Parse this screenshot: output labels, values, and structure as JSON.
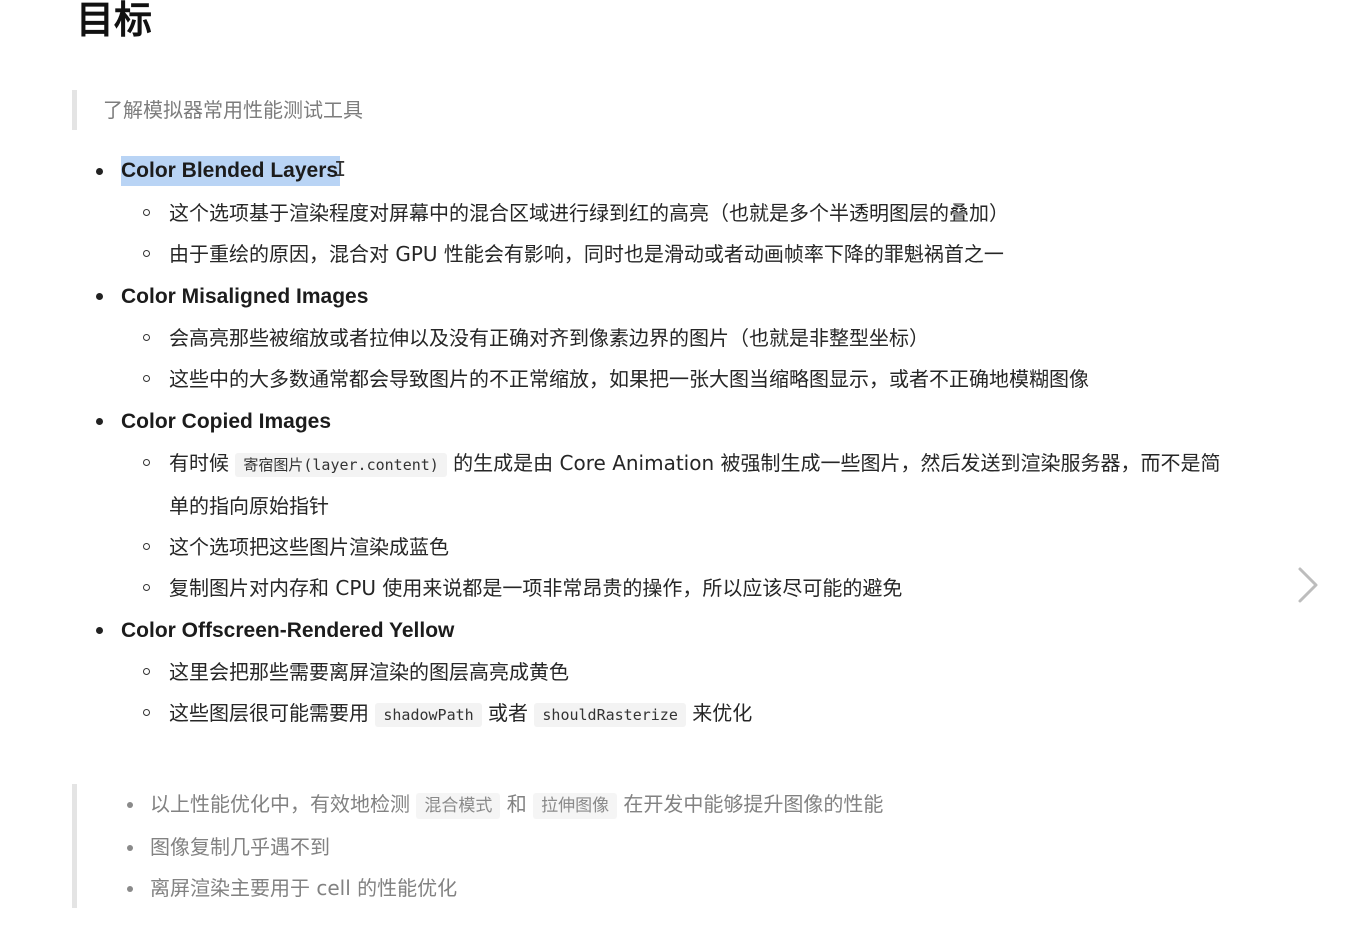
{
  "title": "目标",
  "intro_quote": "了解模拟器常用性能测试工具",
  "sections": [
    {
      "heading": "Color Blended Layers",
      "items": [
        {
          "text": "这个选项基于渲染程度对屏幕中的混合区域进行绿到红的高亮（也就是多个半透明图层的叠加）"
        },
        {
          "text": "由于重绘的原因，混合对 GPU 性能会有影响，同时也是滑动或者动画帧率下降的罪魁祸首之一"
        }
      ]
    },
    {
      "heading": "Color Misaligned Images",
      "items": [
        {
          "text": "会高亮那些被缩放或者拉伸以及没有正确对齐到像素边界的图片（也就是非整型坐标）"
        },
        {
          "text": "这些中的大多数通常都会导致图片的不正常缩放，如果把一张大图当缩略图显示，或者不正确地模糊图像"
        }
      ]
    },
    {
      "heading": "Color Copied Images",
      "items": [
        {
          "pre": "有时候 ",
          "code": "寄宿图片(layer.content)",
          "post": " 的生成是由 Core Animation 被强制生成一些图片，然后发送到渲染服务器，而不是简单的指向原始指针"
        },
        {
          "text": "这个选项把这些图片渲染成蓝色"
        },
        {
          "text": "复制图片对内存和 CPU 使用来说都是一项非常昂贵的操作，所以应该尽可能的避免"
        }
      ]
    },
    {
      "heading": "Color Offscreen-Rendered Yellow",
      "items": [
        {
          "text": "这里会把那些需要离屏渲染的图层高亮成黄色"
        },
        {
          "pre": "这些图层很可能需要用 ",
          "code": "shadowPath",
          "mid": " 或者 ",
          "code2": "shouldRasterize",
          "post": " 来优化"
        }
      ]
    }
  ],
  "summary_quote": {
    "line1": {
      "pre": "以上性能优化中，有效地检测 ",
      "code1": "混合模式",
      "mid": " 和 ",
      "code2": "拉伸图像",
      "post": " 在开发中能够提升图像的性能"
    },
    "line2": "图像复制几乎遇不到",
    "line3": "离屏渲染主要用于 cell 的性能优化"
  },
  "icons": {
    "next": "chevron-right-icon",
    "cursor": "text-cursor-icon"
  }
}
